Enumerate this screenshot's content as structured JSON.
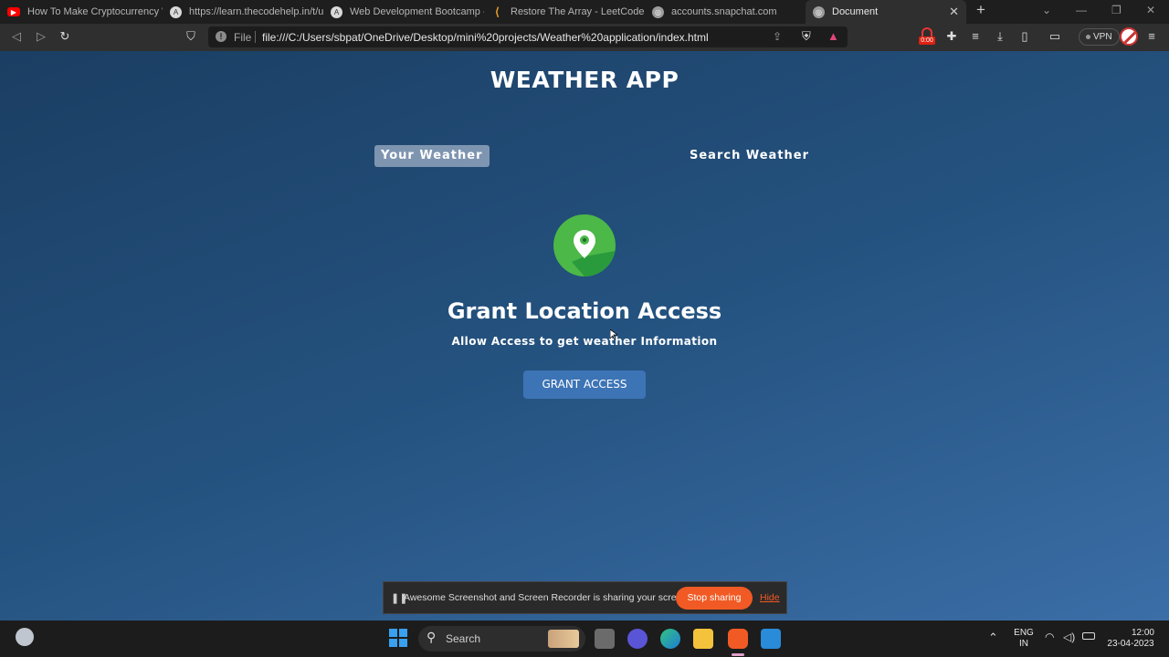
{
  "browser": {
    "tabs": [
      {
        "title": "How To Make Cryptocurrency W",
        "favicon": "youtube-icon",
        "color": "#ff0000"
      },
      {
        "title": "https://learn.thecodehelp.in/t/u/",
        "favicon": "codehelp-icon",
        "color": "#d9d9d9"
      },
      {
        "title": "Web Development Bootcamp - C",
        "favicon": "codehelp-icon",
        "color": "#d9d9d9"
      },
      {
        "title": "Restore The Array - LeetCode",
        "favicon": "leetcode-icon",
        "color": "#f0a02b"
      },
      {
        "title": "accounts.snapchat.com",
        "favicon": "globe-icon",
        "color": "#9c9c9c"
      },
      {
        "title": "Document",
        "favicon": "globe-icon",
        "color": "#9c9c9c"
      }
    ],
    "address": {
      "scheme_label": "File",
      "url": "file:///C:/Users/sbpat/OneDrive/Desktop/mini%20projects/Weather%20application/index.html"
    },
    "vpn_label": "VPN",
    "recorder_time": "0:00"
  },
  "app": {
    "title": "WEATHER APP",
    "tabs": [
      "Your Weather",
      "Search Weather"
    ],
    "selected_tab": "Your Weather",
    "grant": {
      "title": "Grant Location Access",
      "subtitle": "Allow Access to get weather Information",
      "button": "GRANT ACCESS"
    }
  },
  "share_banner": {
    "message": "Awesome Screenshot and Screen Recorder is sharing your screen.",
    "stop_label": "Stop sharing",
    "hide_label": "Hide"
  },
  "taskbar": {
    "search_label": "Search",
    "language": "ENG",
    "region": "IN",
    "time": "12:00",
    "date": "23-04-2023"
  },
  "colors": {
    "page_gradient_start": "#1b3e63",
    "page_gradient_end": "#3b6ea7",
    "pin_green": "#4cb847",
    "grant_button": "#3d74b5",
    "stop_button": "#f15a24"
  }
}
